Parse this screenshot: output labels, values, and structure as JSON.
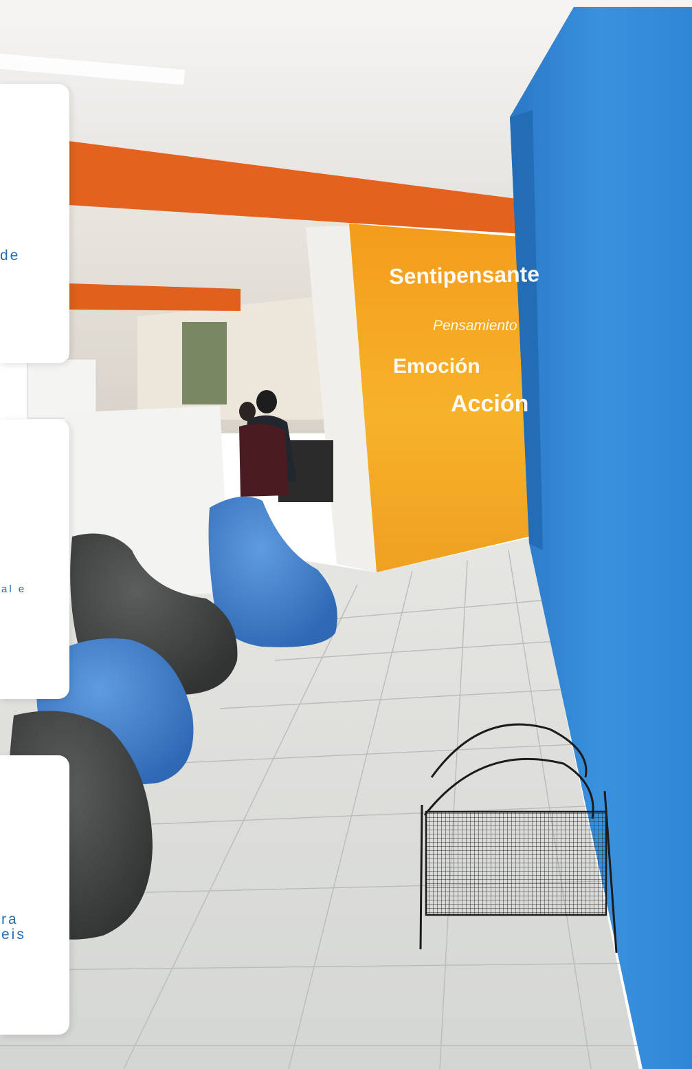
{
  "photo": {
    "colors": {
      "blue_wall": "#2f86d6",
      "orange_wall": "#f2a321",
      "orange_beam": "#e2621e",
      "ceiling": "#f1f0ee",
      "floor": "#d9dbd8",
      "beanbag_blue": "#3f7fcf",
      "beanbag_grey": "#4a4c4c"
    },
    "wall_lettering": {
      "line1": "Sentipensante",
      "line2": "Pensamiento",
      "line3": "Emoción",
      "line4": "Acción"
    }
  },
  "cards": [
    {
      "text_fragment": "de"
    },
    {
      "text_fragment": "al e"
    },
    {
      "text_fragment_lines": [
        "ra",
        "eis"
      ]
    }
  ]
}
